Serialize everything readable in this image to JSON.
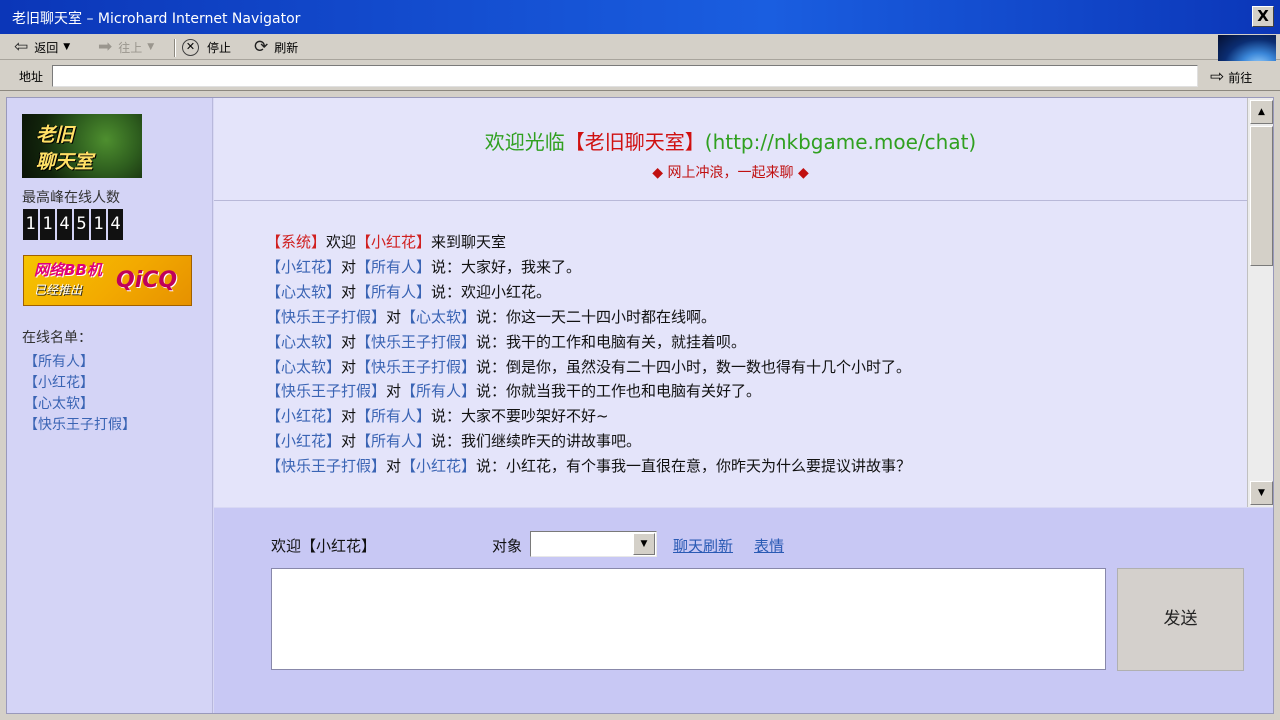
{
  "window": {
    "title": "老旧聊天室 – Microhard Internet Navigator",
    "close_glyph": "X"
  },
  "toolbar": {
    "back_label": "返回",
    "back_icon": "arrow-left-icon",
    "forward_label": "往上",
    "forward_icon": "arrow-right-icon",
    "stop_label": "停止",
    "stop_icon": "stop-icon",
    "refresh_label": "刷新",
    "refresh_icon": "refresh-icon"
  },
  "addressbar": {
    "label": "地址",
    "url": "",
    "go_label": "前往"
  },
  "sidebar": {
    "logo_line1": "老旧",
    "logo_line2": "聊天室",
    "peak_label": "最高峰在线人数",
    "peak_digits": [
      "1",
      "1",
      "4",
      "5",
      "1",
      "4"
    ],
    "banner_line1": "网络BB机",
    "banner_line2": "已经推出",
    "banner_brand": "QiCQ",
    "online_title": "在线名单：",
    "online_users": [
      "【所有人】",
      "【小红花】",
      "【心太软】",
      "【快乐王子打假】"
    ]
  },
  "header": {
    "welcome_prefix": "欢迎光临",
    "welcome_name": "【老旧聊天室】",
    "welcome_url": "(http://nkbgame.moe/chat)",
    "subtitle": "◆ 网上冲浪，一起来聊 ◆"
  },
  "messages": [
    {
      "pre": "【系统】",
      "mid1": "欢迎",
      "name": "【小红花】",
      "post": "来到聊天室"
    },
    {
      "from": "【小红花】",
      "to": "【所有人】",
      "text": "说：大家好，我来了。"
    },
    {
      "from": "【心太软】",
      "to": "【所有人】",
      "text": "说：欢迎小红花。"
    },
    {
      "from": "【快乐王子打假】",
      "to": "【心太软】",
      "text": "说：你这一天二十四小时都在线啊。"
    },
    {
      "from": "【心太软】",
      "to": "【快乐王子打假】",
      "text": "说：我干的工作和电脑有关，就挂着呗。"
    },
    {
      "from": "【心太软】",
      "to": "【快乐王子打假】",
      "text": "说：倒是你，虽然没有二十四小时，数一数也得有十几个小时了。"
    },
    {
      "from": "【快乐王子打假】",
      "to": "【所有人】",
      "text": "说：你就当我干的工作也和电脑有关好了。"
    },
    {
      "from": "【小红花】",
      "to": "【所有人】",
      "text": "说：大家不要吵架好不好~"
    },
    {
      "from": "【小红花】",
      "to": "【所有人】",
      "text": "说：我们继续昨天的讲故事吧。"
    },
    {
      "from": "【快乐王子打假】",
      "to": "【小红花】",
      "text": "说：小红花，有个事我一直很在意，你昨天为什么要提议讲故事？"
    }
  ],
  "connector": "对",
  "input": {
    "welcome": "欢迎【小红花】",
    "target_label": "对象",
    "target_value": "",
    "refresh_link": "聊天刷新",
    "emote_link": "表情",
    "message_text": "",
    "send_label": "发送"
  },
  "colors": {
    "title_bar": "#0b36b8",
    "user_name": "#3a64b4",
    "system_red": "#d02020",
    "welcome_green": "#30a020",
    "link_blue": "#2a5ab4"
  }
}
